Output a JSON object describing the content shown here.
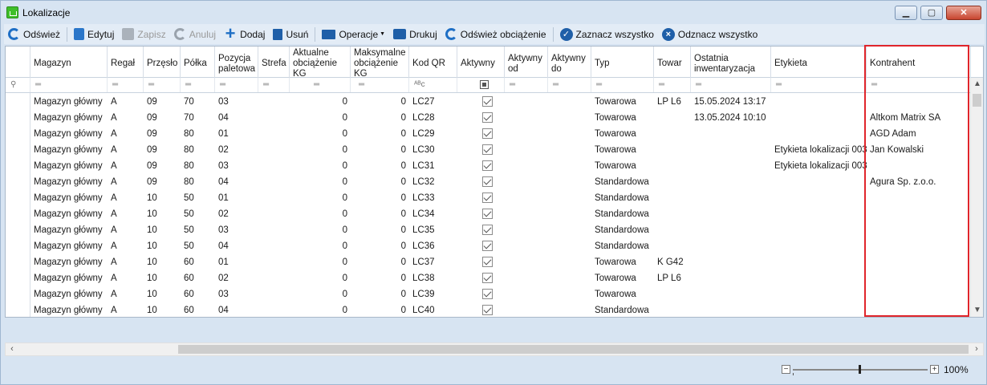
{
  "window": {
    "title": "Lokalizacje"
  },
  "toolbar": {
    "refresh": "Odśwież",
    "edit": "Edytuj",
    "save": "Zapisz",
    "cancel": "Anuluj",
    "add": "Dodaj",
    "delete": "Usuń",
    "operations": "Operacje",
    "print": "Drukuj",
    "refresh_load": "Odśwież obciążenie",
    "select_all": "Zaznacz wszystko",
    "deselect_all": "Odznacz wszystko"
  },
  "columns": {
    "magazyn": "Magazyn",
    "regal": "Regał",
    "przeslo": "Przęsło",
    "polka": "Półka",
    "pozycja": "Pozycja paletowa",
    "strefa": "Strefa",
    "aktualne": "Aktualne obciążenie KG",
    "maksymalne": "Maksymalne obciążenie KG",
    "kodqr": "Kod QR",
    "aktywny": "Aktywny",
    "aktywny_od": "Aktywny od",
    "aktywny_do": "Aktywny do",
    "typ": "Typ",
    "towar": "Towar",
    "inwentaryzacja": "Ostatnia inwentaryzacja",
    "etykieta": "Etykieta",
    "kontrahent": "Kontrahent"
  },
  "filter_row": {
    "text_filter": "═",
    "qr_filter": "ᴬᴮc"
  },
  "rows": [
    {
      "magazyn": "Magazyn główny",
      "regal": "A",
      "przeslo": "09",
      "polka": "70",
      "pozycja": "03",
      "strefa": "",
      "aktualne": "0",
      "maksymalne": "0",
      "kodqr": "LC27",
      "aktywny": true,
      "typ": "Towarowa",
      "towar": "LP L6",
      "inwentaryzacja": "15.05.2024 13:17",
      "etykieta": "",
      "kontrahent": ""
    },
    {
      "magazyn": "Magazyn główny",
      "regal": "A",
      "przeslo": "09",
      "polka": "70",
      "pozycja": "04",
      "strefa": "",
      "aktualne": "0",
      "maksymalne": "0",
      "kodqr": "LC28",
      "aktywny": true,
      "typ": "Towarowa",
      "towar": "",
      "inwentaryzacja": "13.05.2024 10:10",
      "etykieta": "",
      "kontrahent": "Altkom Matrix SA"
    },
    {
      "magazyn": "Magazyn główny",
      "regal": "A",
      "przeslo": "09",
      "polka": "80",
      "pozycja": "01",
      "strefa": "",
      "aktualne": "0",
      "maksymalne": "0",
      "kodqr": "LC29",
      "aktywny": true,
      "typ": "Towarowa",
      "towar": "",
      "inwentaryzacja": "",
      "etykieta": "",
      "kontrahent": "AGD Adam"
    },
    {
      "magazyn": "Magazyn główny",
      "regal": "A",
      "przeslo": "09",
      "polka": "80",
      "pozycja": "02",
      "strefa": "",
      "aktualne": "0",
      "maksymalne": "0",
      "kodqr": "LC30",
      "aktywny": true,
      "typ": "Towarowa",
      "towar": "",
      "inwentaryzacja": "",
      "etykieta": "Etykieta lokalizacji 003",
      "kontrahent": "Jan Kowalski"
    },
    {
      "magazyn": "Magazyn główny",
      "regal": "A",
      "przeslo": "09",
      "polka": "80",
      "pozycja": "03",
      "strefa": "",
      "aktualne": "0",
      "maksymalne": "0",
      "kodqr": "LC31",
      "aktywny": true,
      "typ": "Towarowa",
      "towar": "",
      "inwentaryzacja": "",
      "etykieta": "Etykieta lokalizacji 003",
      "kontrahent": ""
    },
    {
      "magazyn": "Magazyn główny",
      "regal": "A",
      "przeslo": "09",
      "polka": "80",
      "pozycja": "04",
      "strefa": "",
      "aktualne": "0",
      "maksymalne": "0",
      "kodqr": "LC32",
      "aktywny": true,
      "typ": "Standardowa",
      "towar": "",
      "inwentaryzacja": "",
      "etykieta": "",
      "kontrahent": "Agura Sp. z.o.o."
    },
    {
      "magazyn": "Magazyn główny",
      "regal": "A",
      "przeslo": "10",
      "polka": "50",
      "pozycja": "01",
      "strefa": "",
      "aktualne": "0",
      "maksymalne": "0",
      "kodqr": "LC33",
      "aktywny": true,
      "typ": "Standardowa",
      "towar": "",
      "inwentaryzacja": "",
      "etykieta": "",
      "kontrahent": ""
    },
    {
      "magazyn": "Magazyn główny",
      "regal": "A",
      "przeslo": "10",
      "polka": "50",
      "pozycja": "02",
      "strefa": "",
      "aktualne": "0",
      "maksymalne": "0",
      "kodqr": "LC34",
      "aktywny": true,
      "typ": "Standardowa",
      "towar": "",
      "inwentaryzacja": "",
      "etykieta": "",
      "kontrahent": ""
    },
    {
      "magazyn": "Magazyn główny",
      "regal": "A",
      "przeslo": "10",
      "polka": "50",
      "pozycja": "03",
      "strefa": "",
      "aktualne": "0",
      "maksymalne": "0",
      "kodqr": "LC35",
      "aktywny": true,
      "typ": "Standardowa",
      "towar": "",
      "inwentaryzacja": "",
      "etykieta": "",
      "kontrahent": ""
    },
    {
      "magazyn": "Magazyn główny",
      "regal": "A",
      "przeslo": "10",
      "polka": "50",
      "pozycja": "04",
      "strefa": "",
      "aktualne": "0",
      "maksymalne": "0",
      "kodqr": "LC36",
      "aktywny": true,
      "typ": "Standardowa",
      "towar": "",
      "inwentaryzacja": "",
      "etykieta": "",
      "kontrahent": ""
    },
    {
      "magazyn": "Magazyn główny",
      "regal": "A",
      "przeslo": "10",
      "polka": "60",
      "pozycja": "01",
      "strefa": "",
      "aktualne": "0",
      "maksymalne": "0",
      "kodqr": "LC37",
      "aktywny": true,
      "typ": "Towarowa",
      "towar": "K G42",
      "inwentaryzacja": "",
      "etykieta": "",
      "kontrahent": ""
    },
    {
      "magazyn": "Magazyn główny",
      "regal": "A",
      "przeslo": "10",
      "polka": "60",
      "pozycja": "02",
      "strefa": "",
      "aktualne": "0",
      "maksymalne": "0",
      "kodqr": "LC38",
      "aktywny": true,
      "typ": "Towarowa",
      "towar": "LP L6",
      "inwentaryzacja": "",
      "etykieta": "",
      "kontrahent": ""
    },
    {
      "magazyn": "Magazyn główny",
      "regal": "A",
      "przeslo": "10",
      "polka": "60",
      "pozycja": "03",
      "strefa": "",
      "aktualne": "0",
      "maksymalne": "0",
      "kodqr": "LC39",
      "aktywny": true,
      "typ": "Towarowa",
      "towar": "",
      "inwentaryzacja": "",
      "etykieta": "",
      "kontrahent": ""
    },
    {
      "magazyn": "Magazyn główny",
      "regal": "A",
      "przeslo": "10",
      "polka": "60",
      "pozycja": "04",
      "strefa": "",
      "aktualne": "0",
      "maksymalne": "0",
      "kodqr": "LC40",
      "aktywny": true,
      "typ": "Standardowa",
      "towar": "",
      "inwentaryzacja": "",
      "etykieta": "",
      "kontrahent": ""
    }
  ],
  "status": {
    "zoom": "100%"
  },
  "colors": {
    "highlight": "#e0252b",
    "accent": "#1f6fc5"
  }
}
